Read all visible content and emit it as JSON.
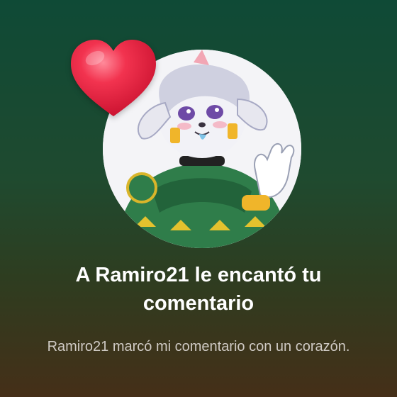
{
  "notification": {
    "title": "A Ramiro21 le encantó tu comentario",
    "body": "Ramiro21 marcó mi comentario con un corazón.",
    "avatar_icon": "user-avatar-illustration",
    "reaction_icon": "heart-icon"
  },
  "colors": {
    "background_top": "#0f4a36",
    "background_bottom": "#452f18",
    "heart": "#e8213f",
    "title_text": "#ffffff",
    "body_text": "#cfcac4"
  }
}
